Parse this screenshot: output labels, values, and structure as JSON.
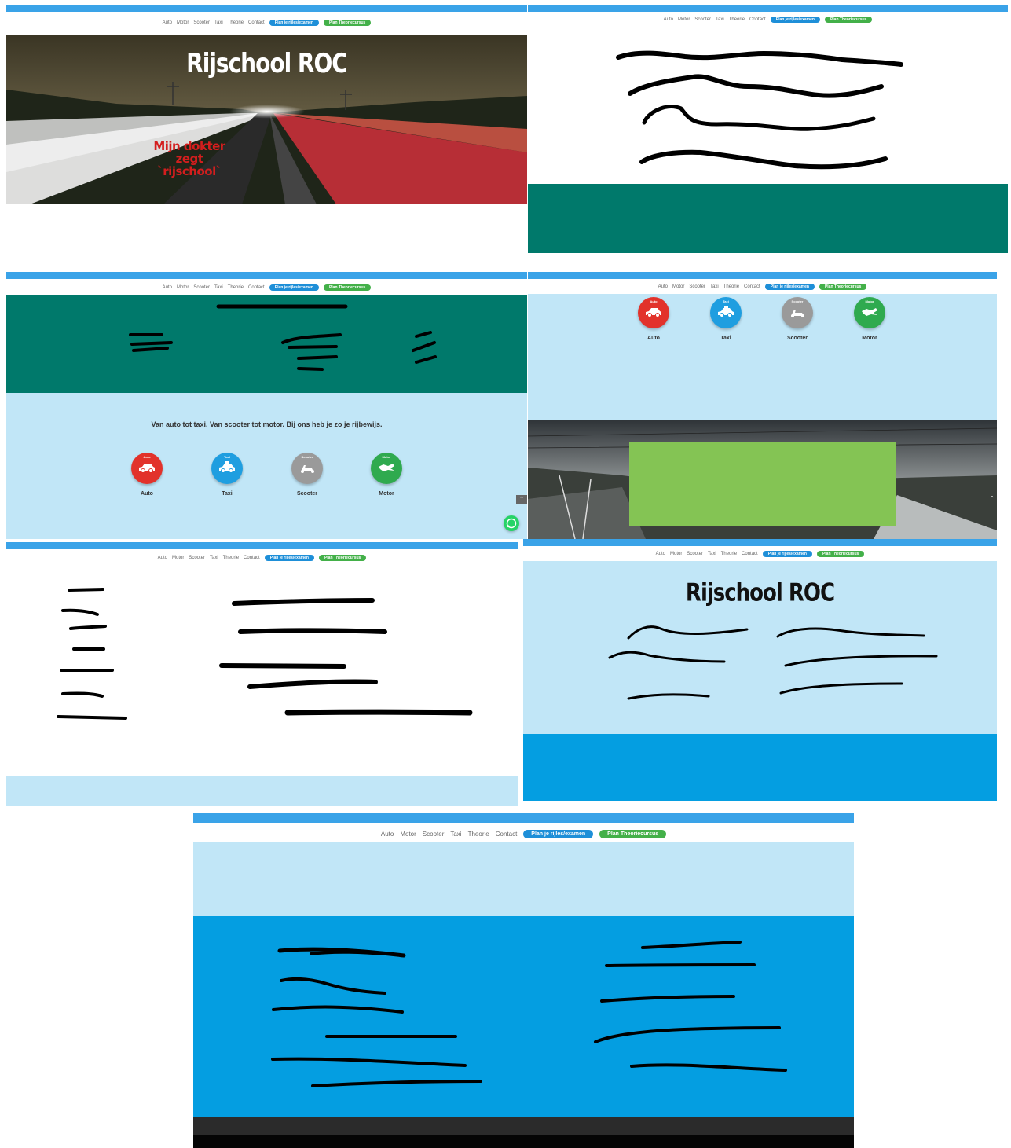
{
  "nav": {
    "links": [
      "Auto",
      "Motor",
      "Scooter",
      "Taxi",
      "Theorie",
      "Contact"
    ],
    "plan_exam": "Plan je rijles/examen",
    "plan_theory": "Plan Theoriecursus"
  },
  "hero": {
    "title": "Rijschool ROC",
    "tagline_line1": "Mijn dokter zegt",
    "tagline_line2": "`rijschool`"
  },
  "services": {
    "heading": "Van auto tot taxi. Van scooter tot motor. Bij ons heb je zo je rijbewijs.",
    "items": [
      {
        "badge": "Auto",
        "name": "Auto",
        "color": "#e2322b"
      },
      {
        "badge": "Taxi",
        "name": "Taxi",
        "color": "#1f9ee0"
      },
      {
        "badge": "Scooter",
        "name": "Scooter",
        "color": "#9a9a9a"
      },
      {
        "badge": "Motor",
        "name": "Motor",
        "color": "#2faa4f"
      }
    ]
  },
  "about": {
    "title": "Rijschool ROC"
  },
  "colors": {
    "topbar": "#3aa3e8",
    "teal": "#00796b",
    "light_blue": "#c1e6f7",
    "strong_blue": "#049ee1",
    "green_box": "#84c454",
    "dark_footer": "#2b2b2b",
    "whatsapp": "#25d366"
  }
}
